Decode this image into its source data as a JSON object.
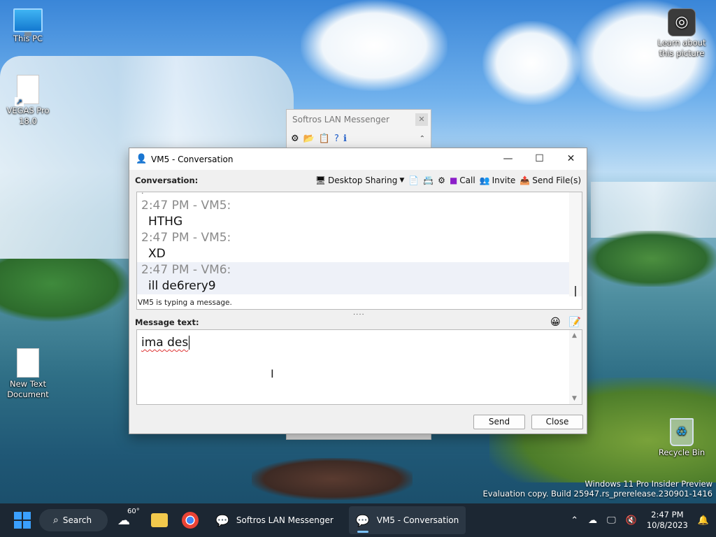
{
  "desktop": {
    "icons": [
      {
        "label": "This PC"
      },
      {
        "label": "VEGAS Pro 18.0"
      },
      {
        "label": "New Text Document"
      },
      {
        "label": "Recycle Bin"
      },
      {
        "label": "Learn about this picture"
      }
    ],
    "watermark": {
      "line1": "Windows 11 Pro Insider Preview",
      "line2": "Evaluation copy. Build 25947.rs_prerelease.230901-1416"
    }
  },
  "messenger_window": {
    "title": "Softros LAN Messenger"
  },
  "conversation_window": {
    "title": "VM5 - Conversation",
    "conversation_label": "Conversation:",
    "toolbar": {
      "desktop_sharing": "Desktop Sharing",
      "call": "Call",
      "invite": "Invite",
      "send_files": "Send File(s)"
    },
    "messages": [
      {
        "header": "2:47 PM - VM5:",
        "text": "HTHG",
        "highlighted": false
      },
      {
        "header": "2:47 PM - VM5:",
        "text": "XD",
        "highlighted": false
      },
      {
        "header": "2:47 PM - VM6:",
        "text": "ill de6rery9",
        "highlighted": true
      }
    ],
    "typing_status": "VM5 is typing a message.",
    "message_text_label": "Message text:",
    "input_value": "ima des",
    "send_label": "Send",
    "close_label": "Close"
  },
  "taskbar": {
    "search_label": "Search",
    "weather_temp": "60°",
    "tasks": [
      {
        "label": "Softros LAN Messenger"
      },
      {
        "label": "VM5 - Conversation"
      }
    ],
    "clock_time": "2:47 PM",
    "clock_date": "10/8/2023"
  },
  "colors": {
    "taskbar_bg": "#1c2733",
    "accent": "#3aa0ff",
    "timestamp_gray": "#8a8a8a"
  }
}
